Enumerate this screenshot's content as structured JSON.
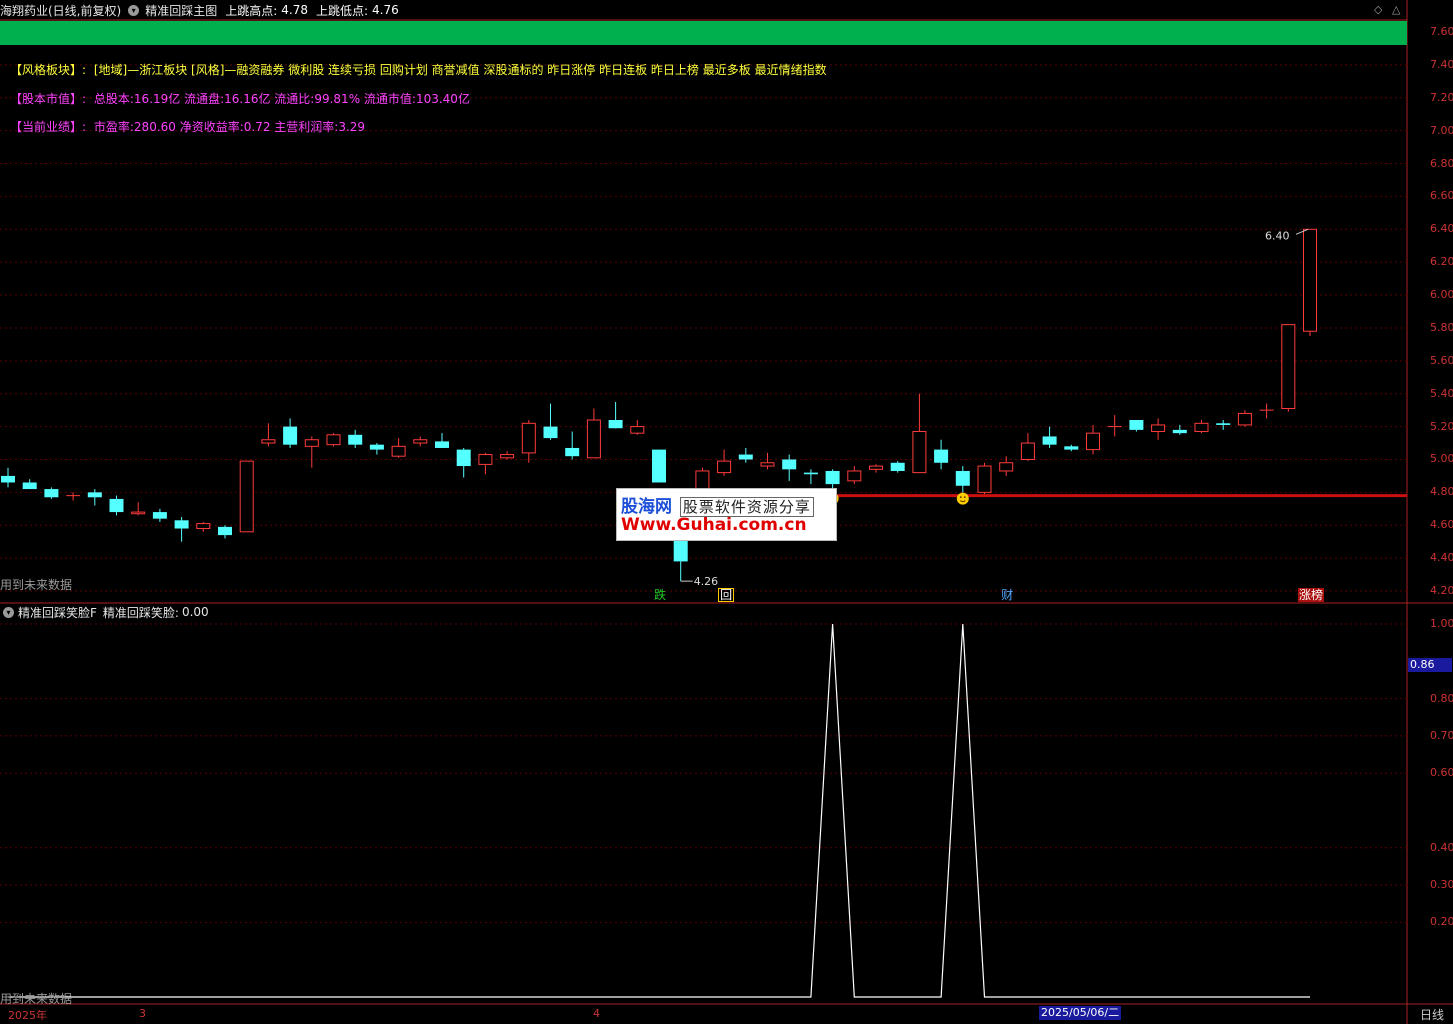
{
  "title_bar": {
    "stock": "海翔药业(日线,前复权)",
    "indicator": "精准回踩主图",
    "high_label": "上跳高点:",
    "high_value": "4.78",
    "low_label": "上跳低点:",
    "low_value": "4.76"
  },
  "info": {
    "style_label": "【风格板块】:",
    "style_value": "[地域]—浙江板块 [风格]—融资融券 微利股 连续亏损 回购计划 商誉减值 深股通标的 昨日涨停 昨日连板 昨日上榜 最近多板 最近情绪指数",
    "capital_label": "【股本市值】:",
    "capital_value": "总股本:16.19亿 流通盘:16.16亿 流通比:99.81% 流通市值:103.40亿",
    "perf_label": "【当前业绩】:",
    "perf_value": "市盈率:280.60 净资收益率:0.72 主营利润率:3.29"
  },
  "future_label": "用到未来数据",
  "sub_panel": {
    "name": "精准回踩笑脸F",
    "series_label": "精准回踩笑脸:",
    "series_value": "0.00",
    "current_value": "0.86"
  },
  "annotations": {
    "high_price": "6.40",
    "low_price": "4.26"
  },
  "markers": [
    {
      "text": "跌",
      "color": "#22cc22"
    },
    {
      "text": "回",
      "color": "#ffffff"
    },
    {
      "text": "财",
      "color": "#55aaff"
    },
    {
      "text": "涨榜",
      "color": "#ffffff"
    }
  ],
  "watermark": {
    "logo": "股海网",
    "text": "股票软件资源分享",
    "url": "Www.Guhai.com.cn"
  },
  "price_axis": [
    "7.60",
    "7.40",
    "7.20",
    "7.00",
    "6.80",
    "6.60",
    "6.40",
    "6.20",
    "6.00",
    "5.80",
    "5.60",
    "5.40",
    "5.20",
    "5.00",
    "4.80",
    "4.60",
    "4.40",
    "4.20"
  ],
  "sub_axis": [
    "1.00",
    "0.80",
    "0.70",
    "0.60",
    "0.40",
    "0.30",
    "0.20"
  ],
  "date_axis": {
    "year": "2025年",
    "m3": "3",
    "m4": "4",
    "selected": "2025/05/06/二",
    "period": "日线"
  },
  "colors": {
    "up": "#ff3b3b",
    "down": "#54ffff",
    "support_line": "#cc1010",
    "background": "#000000",
    "grid": "#5a0000",
    "indicator_line": "#ffffff"
  },
  "chart_data": [
    {
      "type": "candlestick",
      "title": "精准回踩主图",
      "ylim": [
        4.2,
        7.7
      ],
      "support_level": 4.78,
      "candles": [
        {
          "o": 4.9,
          "h": 4.95,
          "l": 4.83,
          "c": 4.86
        },
        {
          "o": 4.86,
          "h": 4.88,
          "l": 4.82,
          "c": 4.82
        },
        {
          "o": 4.82,
          "h": 4.83,
          "l": 4.76,
          "c": 4.77
        },
        {
          "o": 4.78,
          "h": 4.8,
          "l": 4.75,
          "c": 4.78
        },
        {
          "o": 4.8,
          "h": 4.82,
          "l": 4.72,
          "c": 4.77
        },
        {
          "o": 4.76,
          "h": 4.78,
          "l": 4.66,
          "c": 4.68
        },
        {
          "o": 4.67,
          "h": 4.74,
          "l": 4.66,
          "c": 4.68
        },
        {
          "o": 4.68,
          "h": 4.7,
          "l": 4.62,
          "c": 4.64
        },
        {
          "o": 4.63,
          "h": 4.65,
          "l": 4.5,
          "c": 4.58
        },
        {
          "o": 4.58,
          "h": 4.62,
          "l": 4.56,
          "c": 4.61
        },
        {
          "o": 4.59,
          "h": 4.6,
          "l": 4.52,
          "c": 4.54
        },
        {
          "o": 4.56,
          "h": 4.99,
          "l": 4.56,
          "c": 4.99
        },
        {
          "o": 5.1,
          "h": 5.22,
          "l": 5.08,
          "c": 5.12
        },
        {
          "o": 5.2,
          "h": 5.25,
          "l": 5.07,
          "c": 5.09
        },
        {
          "o": 5.08,
          "h": 5.14,
          "l": 4.95,
          "c": 5.12
        },
        {
          "o": 5.09,
          "h": 5.16,
          "l": 5.08,
          "c": 5.15
        },
        {
          "o": 5.15,
          "h": 5.18,
          "l": 5.07,
          "c": 5.09
        },
        {
          "o": 5.09,
          "h": 5.1,
          "l": 5.03,
          "c": 5.06
        },
        {
          "o": 5.02,
          "h": 5.13,
          "l": 5.01,
          "c": 5.08
        },
        {
          "o": 5.1,
          "h": 5.14,
          "l": 5.08,
          "c": 5.12
        },
        {
          "o": 5.11,
          "h": 5.16,
          "l": 5.07,
          "c": 5.07
        },
        {
          "o": 5.06,
          "h": 5.07,
          "l": 4.89,
          "c": 4.96
        },
        {
          "o": 4.97,
          "h": 5.04,
          "l": 4.91,
          "c": 5.03
        },
        {
          "o": 5.01,
          "h": 5.05,
          "l": 5.0,
          "c": 5.03
        },
        {
          "o": 5.04,
          "h": 5.24,
          "l": 4.98,
          "c": 5.22
        },
        {
          "o": 5.2,
          "h": 5.34,
          "l": 5.12,
          "c": 5.13
        },
        {
          "o": 5.07,
          "h": 5.17,
          "l": 5.0,
          "c": 5.02
        },
        {
          "o": 5.01,
          "h": 5.31,
          "l": 5.01,
          "c": 5.24
        },
        {
          "o": 5.24,
          "h": 5.35,
          "l": 5.19,
          "c": 5.19
        },
        {
          "o": 5.16,
          "h": 5.24,
          "l": 5.15,
          "c": 5.2
        },
        {
          "o": 5.06,
          "h": 5.06,
          "l": 4.86,
          "c": 4.86
        },
        {
          "o": 4.62,
          "h": 4.62,
          "l": 4.26,
          "c": 4.38
        },
        {
          "o": 4.78,
          "h": 4.95,
          "l": 4.74,
          "c": 4.93
        },
        {
          "o": 4.92,
          "h": 5.06,
          "l": 4.9,
          "c": 4.99
        },
        {
          "o": 5.03,
          "h": 5.07,
          "l": 4.98,
          "c": 5.0
        },
        {
          "o": 4.96,
          "h": 5.04,
          "l": 4.94,
          "c": 4.98
        },
        {
          "o": 5.0,
          "h": 5.03,
          "l": 4.87,
          "c": 4.94
        },
        {
          "o": 4.92,
          "h": 4.94,
          "l": 4.85,
          "c": 4.91
        },
        {
          "o": 4.93,
          "h": 4.94,
          "l": 4.82,
          "c": 4.85
        },
        {
          "o": 4.87,
          "h": 4.96,
          "l": 4.85,
          "c": 4.93
        },
        {
          "o": 4.94,
          "h": 4.97,
          "l": 4.92,
          "c": 4.96
        },
        {
          "o": 4.98,
          "h": 4.99,
          "l": 4.92,
          "c": 4.93
        },
        {
          "o": 4.92,
          "h": 5.4,
          "l": 4.92,
          "c": 5.17
        },
        {
          "o": 5.06,
          "h": 5.12,
          "l": 4.94,
          "c": 4.98
        },
        {
          "o": 4.93,
          "h": 4.96,
          "l": 4.8,
          "c": 4.84
        },
        {
          "o": 4.8,
          "h": 4.98,
          "l": 4.79,
          "c": 4.96
        },
        {
          "o": 4.93,
          "h": 5.02,
          "l": 4.9,
          "c": 4.98
        },
        {
          "o": 5.0,
          "h": 5.16,
          "l": 4.99,
          "c": 5.1
        },
        {
          "o": 5.14,
          "h": 5.2,
          "l": 5.07,
          "c": 5.09
        },
        {
          "o": 5.08,
          "h": 5.09,
          "l": 5.05,
          "c": 5.06
        },
        {
          "o": 5.06,
          "h": 5.21,
          "l": 5.03,
          "c": 5.16
        },
        {
          "o": 5.2,
          "h": 5.27,
          "l": 5.14,
          "c": 5.2
        },
        {
          "o": 5.24,
          "h": 5.24,
          "l": 5.17,
          "c": 5.18
        },
        {
          "o": 5.17,
          "h": 5.25,
          "l": 5.12,
          "c": 5.21
        },
        {
          "o": 5.18,
          "h": 5.21,
          "l": 5.15,
          "c": 5.16
        },
        {
          "o": 5.17,
          "h": 5.24,
          "l": 5.16,
          "c": 5.22
        },
        {
          "o": 5.22,
          "h": 5.24,
          "l": 5.18,
          "c": 5.21
        },
        {
          "o": 5.21,
          "h": 5.3,
          "l": 5.2,
          "c": 5.28
        },
        {
          "o": 5.3,
          "h": 5.34,
          "l": 5.25,
          "c": 5.3
        },
        {
          "o": 5.31,
          "h": 5.82,
          "l": 5.29,
          "c": 5.82
        },
        {
          "o": 5.78,
          "h": 6.4,
          "l": 5.75,
          "c": 6.4
        }
      ],
      "smiley_indices": [
        38,
        44
      ],
      "marker_indices": [
        30,
        33,
        46,
        60
      ]
    },
    {
      "type": "line",
      "title": "精准回踩笑脸F",
      "ylim": [
        0,
        1.08
      ],
      "values": [
        0,
        0,
        0,
        0,
        0,
        0,
        0,
        0,
        0,
        0,
        0,
        0,
        0,
        0,
        0,
        0,
        0,
        0,
        0,
        0,
        0,
        0,
        0,
        0,
        0,
        0,
        0,
        0,
        0,
        0,
        0,
        0,
        0,
        0,
        0,
        0,
        0,
        0,
        1,
        0,
        0,
        0,
        0,
        0,
        1,
        0,
        0,
        0,
        0,
        0,
        0,
        0,
        0,
        0,
        0,
        0,
        0,
        0,
        0,
        0,
        0
      ]
    }
  ]
}
